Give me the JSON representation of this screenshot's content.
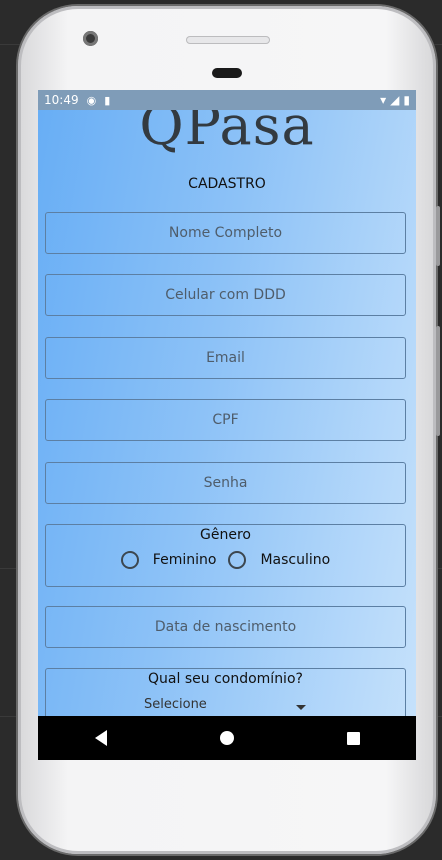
{
  "status_bar": {
    "time": "10:49"
  },
  "app": {
    "logo": "QPasa",
    "subtitle": "CADASTRO"
  },
  "form": {
    "fields": [
      {
        "placeholder": "Nome Completo"
      },
      {
        "placeholder": "Celular com DDD"
      },
      {
        "placeholder": "Email"
      },
      {
        "placeholder": "CPF"
      },
      {
        "placeholder": "Senha"
      }
    ],
    "gender": {
      "label": "Gênero",
      "options": [
        "Feminino",
        "Masculino"
      ]
    },
    "birthdate": {
      "placeholder": "Data de nascimento"
    },
    "condo": {
      "label": "Qual seu condomínio?",
      "selected": "Selecione"
    }
  }
}
